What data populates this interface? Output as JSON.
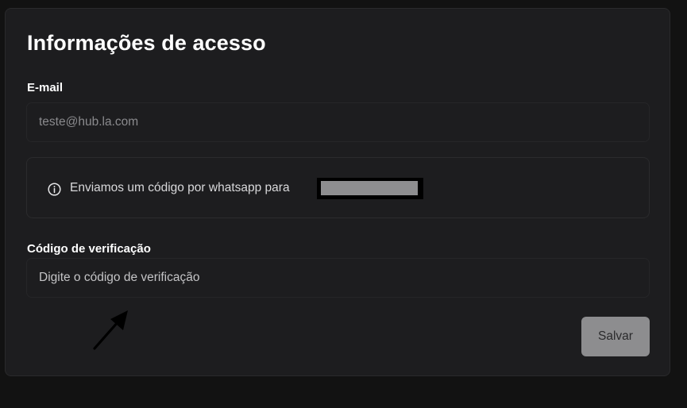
{
  "card": {
    "title": "Informações de acesso"
  },
  "email": {
    "label": "E-mail",
    "value": "teste@hub.la.com"
  },
  "notice": {
    "icon": "info-circle-icon",
    "text": "Enviamos um código por whatsapp para",
    "phone_redacted": true
  },
  "verification": {
    "label": "Código de verificação",
    "placeholder": "Digite o código de verificação"
  },
  "actions": {
    "save_label": "Salvar"
  },
  "colors": {
    "page_background": "#121212",
    "card_background": "#1d1d1f",
    "button_background": "#8d8d8f",
    "redaction": "#000000"
  }
}
